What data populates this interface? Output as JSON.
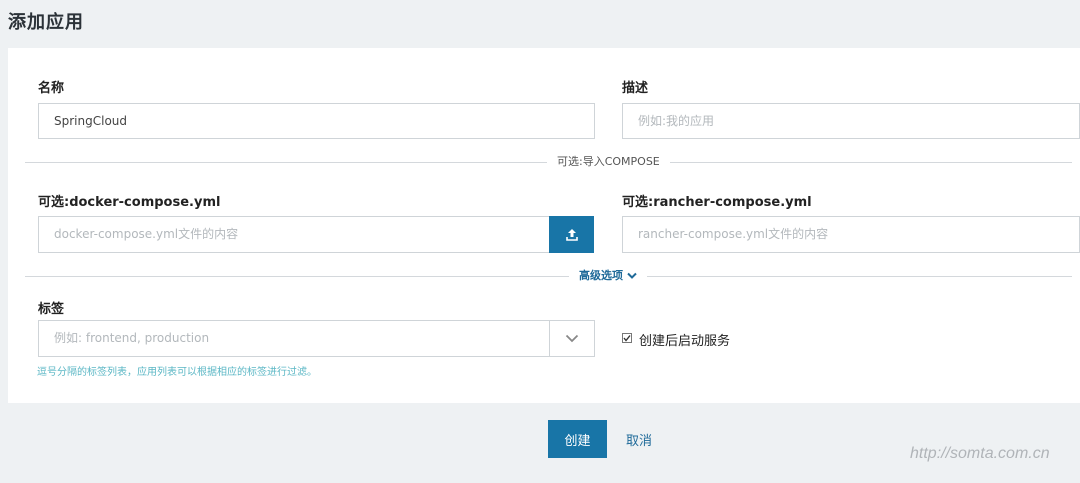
{
  "page": {
    "title": "添加应用"
  },
  "form": {
    "name": {
      "label": "名称",
      "value": "SpringCloud"
    },
    "description": {
      "label": "描述",
      "placeholder": "例如:我的应用"
    },
    "import_divider": "可选:导入COMPOSE",
    "docker_compose": {
      "label": "可选:docker-compose.yml",
      "placeholder": "docker-compose.yml文件的内容"
    },
    "rancher_compose": {
      "label": "可选:rancher-compose.yml",
      "placeholder": "rancher-compose.yml文件的内容"
    },
    "advanced_toggle": "高级选项",
    "tags": {
      "label": "标签",
      "placeholder": "例如: frontend, production",
      "help": "逗号分隔的标签列表，应用列表可以根据相应的标签进行过滤。"
    },
    "start_after_create": {
      "label": "创建后启动服务",
      "checked": true
    }
  },
  "actions": {
    "create_label": "创建",
    "cancel_label": "取消"
  },
  "watermark": "http://somta.com.cn",
  "icons": {
    "upload": "upload-icon",
    "chevron": "chevron-down-icon",
    "check": "check-icon"
  },
  "colors": {
    "primary": "#1875a7",
    "link": "#1f6a99",
    "help": "#5bb7c5",
    "background": "#eef1f3"
  }
}
